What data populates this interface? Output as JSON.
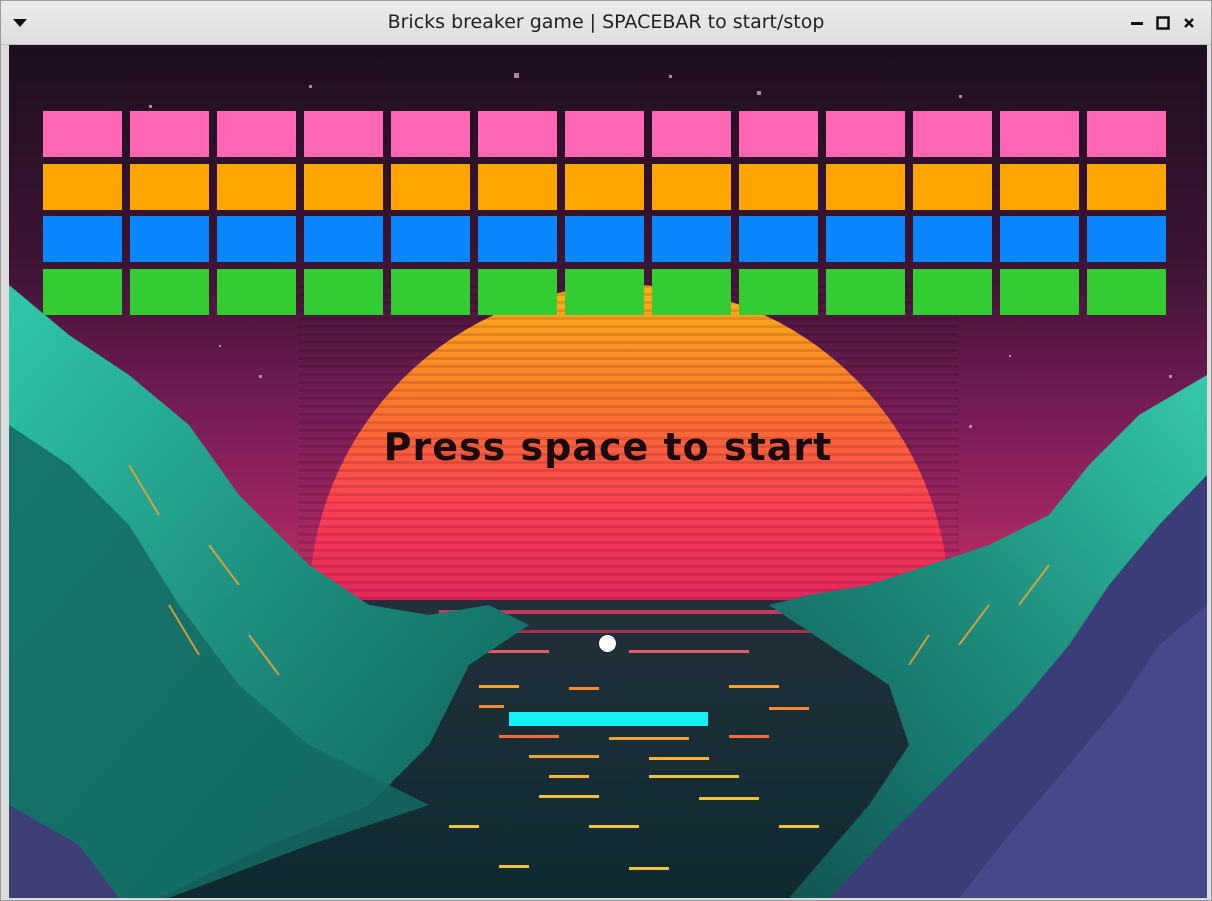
{
  "window": {
    "title": "Bricks breaker game | SPACEBAR to start/stop",
    "menu_icon": "triangle-down-icon",
    "controls": [
      "minimize-icon",
      "maximize-icon",
      "close-icon"
    ]
  },
  "game": {
    "message": "Press space to start",
    "brick_rows": [
      {
        "row": "pink",
        "color": "#ff66b3",
        "count": 13
      },
      {
        "row": "orange",
        "color": "#ffa500",
        "count": 13
      },
      {
        "row": "blue",
        "color": "#0a86ff",
        "count": 13
      },
      {
        "row": "green",
        "color": "#34cc33",
        "count": 13
      }
    ],
    "ball_color": "#ffffff",
    "paddle_color": "#14f0f5",
    "background": "synthwave-sunset-mountains-lake"
  }
}
